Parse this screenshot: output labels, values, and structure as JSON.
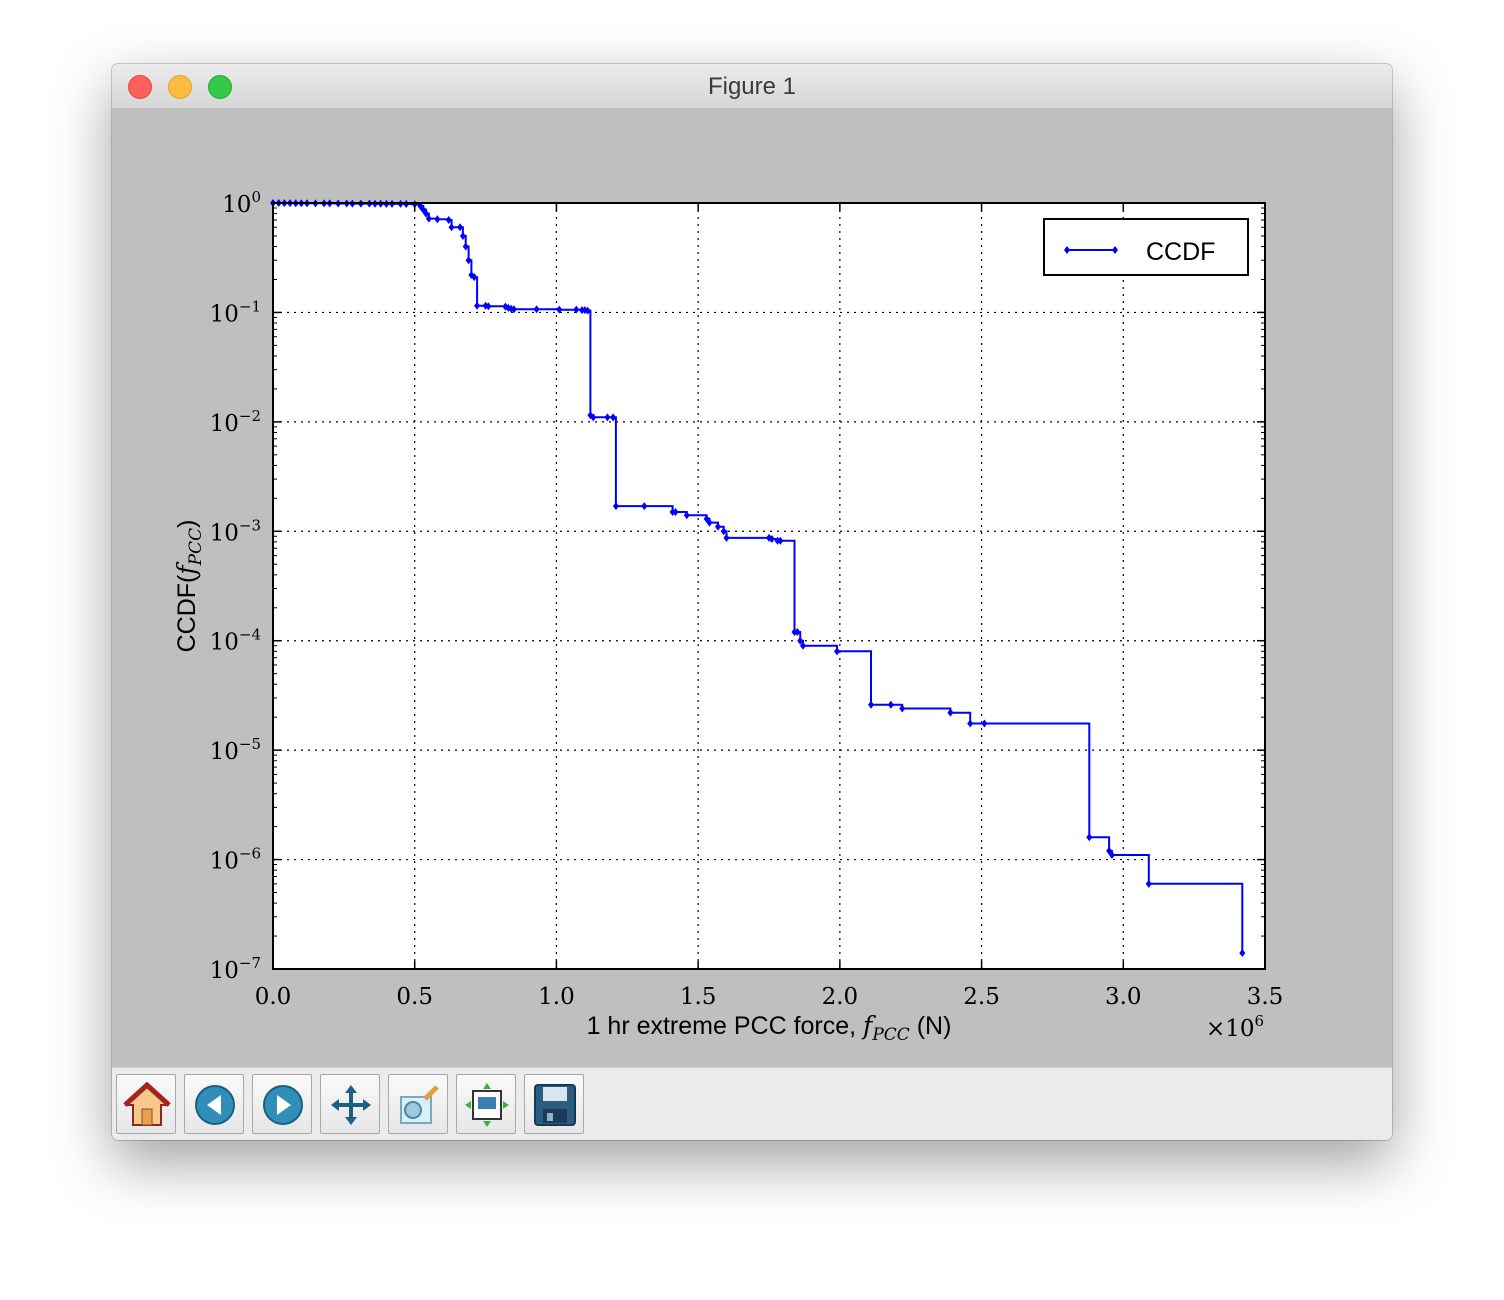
{
  "window": {
    "title": "Figure 1"
  },
  "toolbar": {
    "buttons": [
      {
        "name": "home-button",
        "icon": "home-icon"
      },
      {
        "name": "back-button",
        "icon": "back-arrow-icon"
      },
      {
        "name": "forward-button",
        "icon": "forward-arrow-icon"
      },
      {
        "name": "pan-button",
        "icon": "move-arrows-icon"
      },
      {
        "name": "zoom-button",
        "icon": "zoom-rect-icon"
      },
      {
        "name": "subplots-button",
        "icon": "subplots-config-icon"
      },
      {
        "name": "save-button",
        "icon": "floppy-disk-icon"
      }
    ]
  },
  "chart_data": {
    "type": "line",
    "drawstyle": "steps",
    "marker": "diamond",
    "color": "#0000ff",
    "xlabel_prefix": "1 hr extreme PCC force, ",
    "xlabel_math_main": "f",
    "xlabel_math_sub": "PCC",
    "xlabel_suffix": " (N)",
    "ylabel_prefix": "CCDF(",
    "ylabel_math_main": "f",
    "ylabel_math_sub": "PCC",
    "ylabel_suffix": ")",
    "x_offset_base": "×10",
    "x_offset_exp": "6",
    "x_multiplier": 1000000,
    "xlim": [
      0.0,
      3.5
    ],
    "ylim": [
      1e-07,
      1
    ],
    "yscale": "log",
    "grid": true,
    "legend_position": "upper right",
    "x_ticks": [
      "0.0",
      "0.5",
      "1.0",
      "1.5",
      "2.0",
      "2.5",
      "3.0",
      "3.5"
    ],
    "y_ticks": [
      {
        "base": "10",
        "exp": "0"
      },
      {
        "base": "10",
        "exp": "−1"
      },
      {
        "base": "10",
        "exp": "−2"
      },
      {
        "base": "10",
        "exp": "−3"
      },
      {
        "base": "10",
        "exp": "−4"
      },
      {
        "base": "10",
        "exp": "−5"
      },
      {
        "base": "10",
        "exp": "−6"
      },
      {
        "base": "10",
        "exp": "−7"
      }
    ],
    "series": [
      {
        "name": "CCDF",
        "x": [
          0.0,
          0.02,
          0.04,
          0.06,
          0.08,
          0.1,
          0.12,
          0.15,
          0.18,
          0.2,
          0.23,
          0.26,
          0.28,
          0.31,
          0.34,
          0.36,
          0.38,
          0.4,
          0.42,
          0.45,
          0.47,
          0.5,
          0.52,
          0.53,
          0.54,
          0.55,
          0.58,
          0.62,
          0.63,
          0.66,
          0.67,
          0.68,
          0.69,
          0.7,
          0.71,
          0.72,
          0.75,
          0.76,
          0.82,
          0.83,
          0.84,
          0.85,
          0.93,
          1.01,
          1.07,
          1.09,
          1.1,
          1.11,
          1.12,
          1.13,
          1.18,
          1.2,
          1.21,
          1.31,
          1.41,
          1.42,
          1.46,
          1.53,
          1.54,
          1.57,
          1.59,
          1.6,
          1.75,
          1.76,
          1.78,
          1.79,
          1.84,
          1.85,
          1.86,
          1.87,
          1.99,
          2.11,
          2.18,
          2.22,
          2.39,
          2.46,
          2.51,
          2.88,
          2.95,
          2.96,
          3.09,
          3.42
        ],
        "y": [
          1.0,
          0.999,
          0.998,
          0.997,
          0.996,
          0.995,
          0.994,
          0.993,
          0.992,
          0.991,
          0.99,
          0.989,
          0.988,
          0.987,
          0.986,
          0.985,
          0.984,
          0.983,
          0.982,
          0.981,
          0.98,
          0.975,
          0.94,
          0.87,
          0.8,
          0.72,
          0.71,
          0.7,
          0.6,
          0.6,
          0.5,
          0.4,
          0.3,
          0.22,
          0.21,
          0.115,
          0.115,
          0.114,
          0.113,
          0.11,
          0.108,
          0.107,
          0.107,
          0.106,
          0.106,
          0.105,
          0.105,
          0.104,
          0.0115,
          0.011,
          0.011,
          0.011,
          0.0017,
          0.0017,
          0.0015,
          0.0015,
          0.0014,
          0.0013,
          0.0012,
          0.0011,
          0.001,
          0.00087,
          0.00087,
          0.00085,
          0.00082,
          0.00082,
          0.00012,
          0.00012,
          0.0001,
          9e-05,
          8e-05,
          2.6e-05,
          2.6e-05,
          2.4e-05,
          2.2e-05,
          1.75e-05,
          1.75e-05,
          1.6e-06,
          1.2e-06,
          1.1e-06,
          6e-07,
          1.4e-07
        ]
      }
    ]
  }
}
